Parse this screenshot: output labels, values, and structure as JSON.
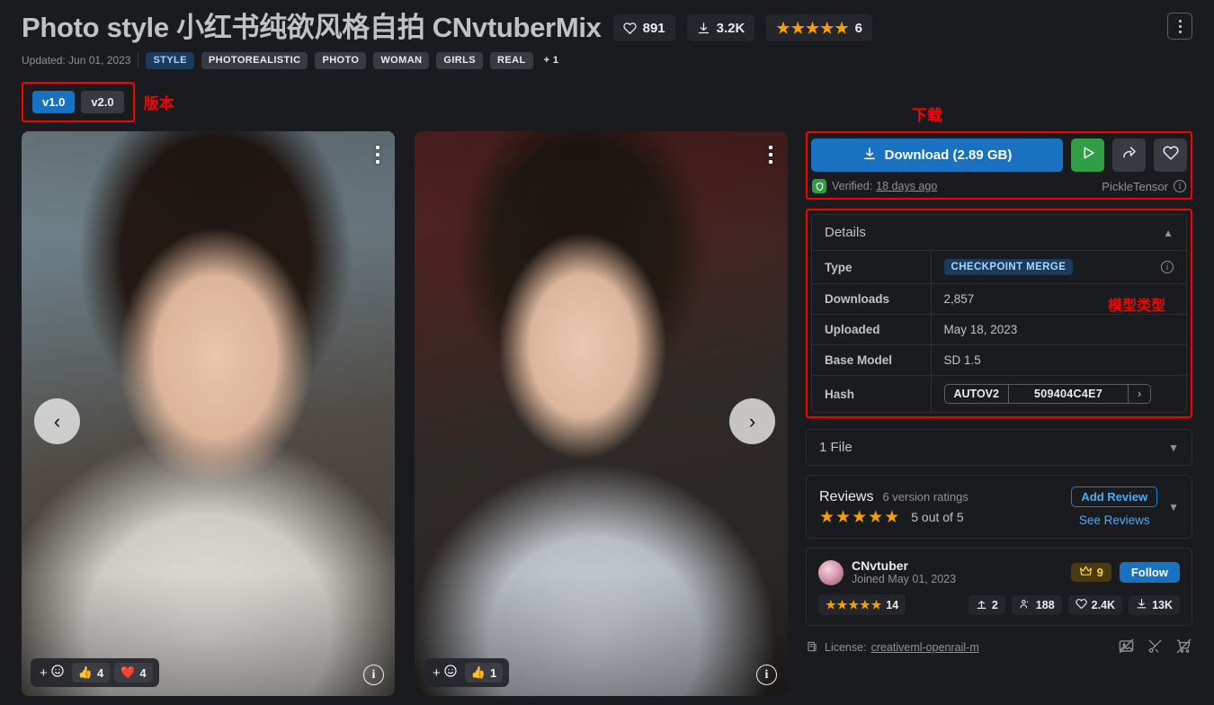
{
  "header": {
    "title": "Photo style 小红书纯欲风格自拍 CNvtuberMix",
    "likes": "891",
    "downloads_short": "3.2K",
    "rating_count": "6",
    "star_count": 5,
    "updated": "Updated: Jun 01, 2023",
    "tags": [
      {
        "label": "STYLE",
        "style": "accent"
      },
      {
        "label": "PHOTOREALISTIC",
        "style": "normal"
      },
      {
        "label": "PHOTO",
        "style": "normal"
      },
      {
        "label": "WOMAN",
        "style": "normal"
      },
      {
        "label": "GIRLS",
        "style": "normal"
      },
      {
        "label": "REAL",
        "style": "normal"
      },
      {
        "label": "+ 1",
        "style": "plain"
      }
    ],
    "kebab": "more-options"
  },
  "versions": {
    "items": [
      {
        "label": "v1.0",
        "active": true
      },
      {
        "label": "v2.0",
        "active": false
      }
    ],
    "annotation": "版本"
  },
  "annotations": {
    "download": "下载",
    "model_type": "模型类型"
  },
  "gallery": {
    "prev": "‹",
    "next": "›",
    "images": [
      {
        "name": "preview-image-1",
        "reactions": [
          {
            "emoji": "👍",
            "count": "4"
          },
          {
            "emoji": "❤️",
            "count": "4"
          }
        ],
        "info": "i"
      },
      {
        "name": "preview-image-2",
        "reactions": [
          {
            "emoji": "👍",
            "count": "1"
          }
        ],
        "info": "i"
      }
    ]
  },
  "download": {
    "button_label": "Download (2.89 GB)",
    "verified_label": "Verified:",
    "verified_time": "18 days ago",
    "scan_format": "PickleTensor",
    "run_button": "run-model",
    "share_button": "share",
    "favorite_button": "favorite"
  },
  "details": {
    "title": "Details",
    "rows": [
      {
        "key": "Type",
        "value": "CHECKPOINT MERGE",
        "kind": "badge"
      },
      {
        "key": "Downloads",
        "value": "2,857",
        "kind": "text"
      },
      {
        "key": "Uploaded",
        "value": "May 18, 2023",
        "kind": "text"
      },
      {
        "key": "Base Model",
        "value": "SD 1.5",
        "kind": "text"
      },
      {
        "key": "Hash",
        "value": "509404C4E7",
        "kind": "hash",
        "algo": "AUTOV2"
      }
    ]
  },
  "files": {
    "title": "1 File"
  },
  "reviews": {
    "title": "Reviews",
    "subtitle": "6 version ratings",
    "score": "5 out of 5",
    "star_count": 5,
    "add_review": "Add Review",
    "see_reviews": "See Reviews"
  },
  "creator": {
    "name": "CNvtuber",
    "joined": "Joined May 01, 2023",
    "crown_count": "9",
    "follow_label": "Follow",
    "rating_count": "14",
    "star_count": 5,
    "stats": [
      {
        "icon": "upload-icon",
        "value": "2"
      },
      {
        "icon": "followers-icon",
        "value": "188"
      },
      {
        "icon": "heart-icon",
        "value": "2.4K"
      },
      {
        "icon": "download-icon",
        "value": "13K"
      }
    ]
  },
  "license": {
    "label": "License:",
    "name": "creativeml-openrail-m",
    "restrictions": [
      "no-image-selling-icon",
      "no-merge-icon",
      "no-sell-model-icon"
    ]
  },
  "colors": {
    "background": "#1a1b1e",
    "primary": "#1971c2",
    "accent_link": "#4dabf7",
    "star": "#f59f00",
    "green": "#2f9e44",
    "annotation_red": "#fa0000"
  }
}
